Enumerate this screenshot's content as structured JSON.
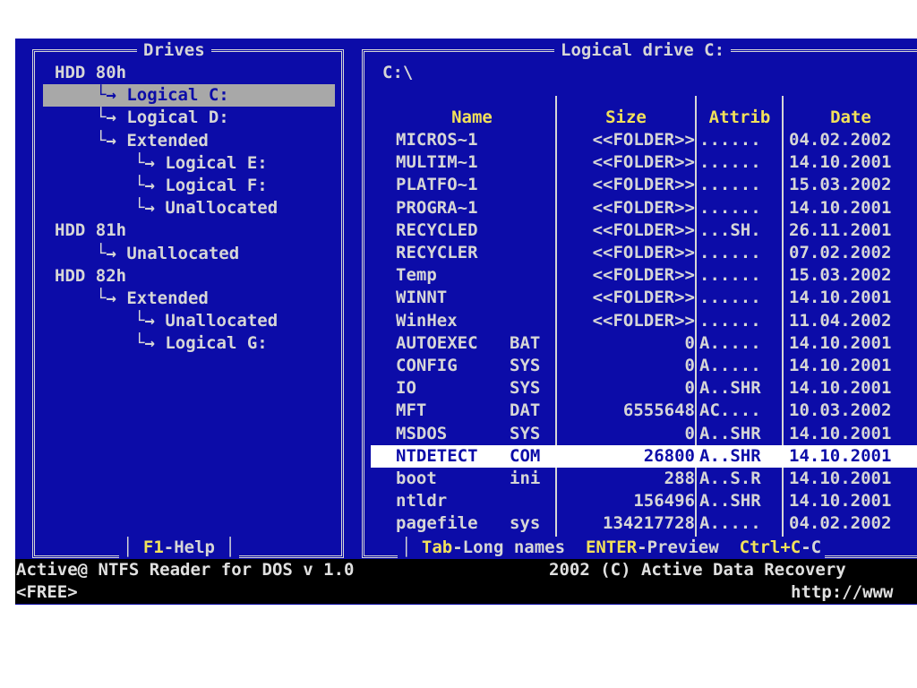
{
  "drives_panel": {
    "title": "Drives",
    "help_key": "F1",
    "help_label": "-Help",
    "tree": [
      {
        "label": "HDD 80h",
        "prefix": ""
      },
      {
        "label": "Logical C:",
        "prefix": "└→ ",
        "selected": true
      },
      {
        "label": "Logical D:",
        "prefix": "└→ "
      },
      {
        "label": "Extended",
        "prefix": "└→ "
      },
      {
        "label": "Logical E:",
        "prefix": "└→ "
      },
      {
        "label": "Logical F:",
        "prefix": "└→ "
      },
      {
        "label": "Unallocated",
        "prefix": "└→ "
      },
      {
        "label": "HDD 81h",
        "prefix": ""
      },
      {
        "label": "Unallocated",
        "prefix": "└→ "
      },
      {
        "label": "HDD 82h",
        "prefix": ""
      },
      {
        "label": "Extended",
        "prefix": "└→ "
      },
      {
        "label": "Unallocated",
        "prefix": "└→ "
      },
      {
        "label": "Logical G:",
        "prefix": "└→ "
      }
    ]
  },
  "files_panel": {
    "title": "Logical drive C:",
    "path": "C:\\",
    "columns": {
      "name": "Name",
      "size": "Size",
      "attrib": "Attrib",
      "date": "Date"
    },
    "rows": [
      {
        "name": "MICROS~1",
        "ext": "",
        "size": "<<FOLDER>>",
        "attrib": "......",
        "date": "04.02.2002"
      },
      {
        "name": "MULTIM~1",
        "ext": "",
        "size": "<<FOLDER>>",
        "attrib": "......",
        "date": "14.10.2001"
      },
      {
        "name": "PLATFO~1",
        "ext": "",
        "size": "<<FOLDER>>",
        "attrib": "......",
        "date": "15.03.2002"
      },
      {
        "name": "PROGRA~1",
        "ext": "",
        "size": "<<FOLDER>>",
        "attrib": "......",
        "date": "14.10.2001"
      },
      {
        "name": "RECYCLED",
        "ext": "",
        "size": "<<FOLDER>>",
        "attrib": "...SH.",
        "date": "26.11.2001"
      },
      {
        "name": "RECYCLER",
        "ext": "",
        "size": "<<FOLDER>>",
        "attrib": "......",
        "date": "07.02.2002"
      },
      {
        "name": "Temp",
        "ext": "",
        "size": "<<FOLDER>>",
        "attrib": "......",
        "date": "15.03.2002"
      },
      {
        "name": "WINNT",
        "ext": "",
        "size": "<<FOLDER>>",
        "attrib": "......",
        "date": "14.10.2001"
      },
      {
        "name": "WinHex",
        "ext": "",
        "size": "<<FOLDER>>",
        "attrib": "......",
        "date": "11.04.2002"
      },
      {
        "name": "AUTOEXEC",
        "ext": "BAT",
        "size": "0",
        "attrib": "A.....",
        "date": "14.10.2001"
      },
      {
        "name": "CONFIG",
        "ext": "SYS",
        "size": "0",
        "attrib": "A.....",
        "date": "14.10.2001"
      },
      {
        "name": "IO",
        "ext": "SYS",
        "size": "0",
        "attrib": "A..SHR",
        "date": "14.10.2001"
      },
      {
        "name": "MFT",
        "ext": "DAT",
        "size": "6555648",
        "attrib": "AC....",
        "date": "10.03.2002"
      },
      {
        "name": "MSDOS",
        "ext": "SYS",
        "size": "0",
        "attrib": "A..SHR",
        "date": "14.10.2001"
      },
      {
        "name": "NTDETECT",
        "ext": "COM",
        "size": "26800",
        "attrib": "A..SHR",
        "date": "14.10.2001",
        "selected": true
      },
      {
        "name": "boot",
        "ext": "ini",
        "size": "288",
        "attrib": "A..S.R",
        "date": "14.10.2001"
      },
      {
        "name": "ntldr",
        "ext": "",
        "size": "156496",
        "attrib": "A..SHR",
        "date": "14.10.2001"
      },
      {
        "name": "pagefile",
        "ext": "sys",
        "size": "134217728",
        "attrib": "A.....",
        "date": "04.02.2002"
      }
    ],
    "hints": [
      {
        "key": "Tab",
        "label": "-Long names"
      },
      {
        "key": "ENTER",
        "label": "-Preview"
      },
      {
        "key": "Ctrl+C",
        "label": "-C"
      }
    ]
  },
  "status": {
    "app_title": "Active@ NTFS Reader for DOS v 1.0",
    "copyright": "2002 (C) Active Data Recovery",
    "free": "<FREE>",
    "url": "http://www"
  }
}
